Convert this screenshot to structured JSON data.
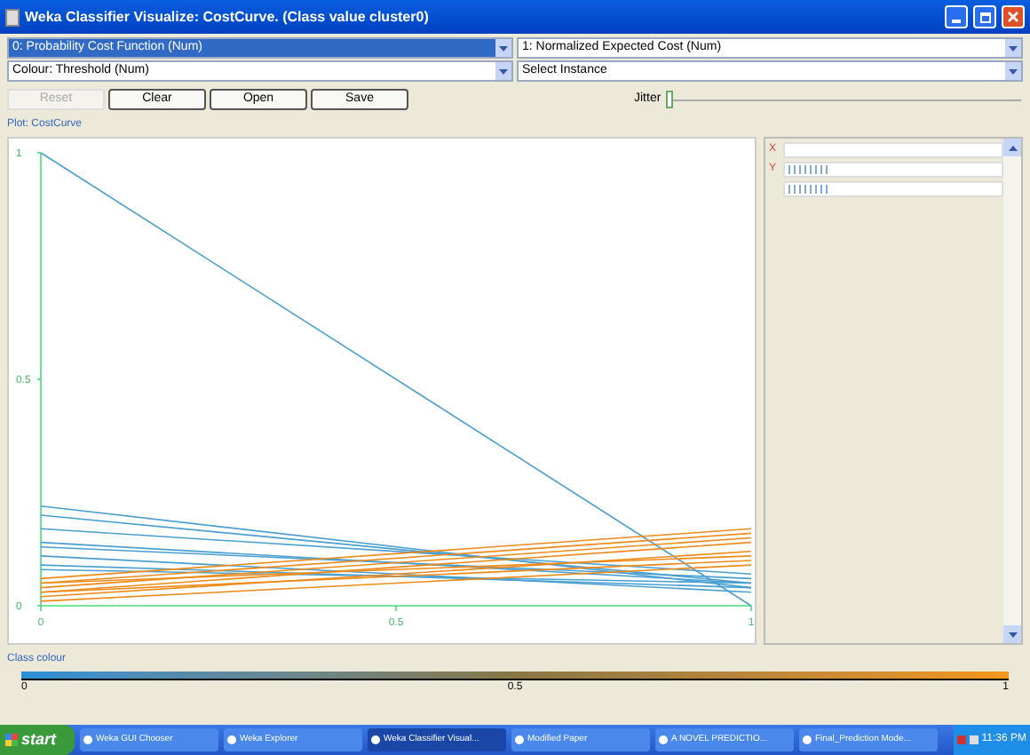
{
  "window": {
    "title": "Weka Classifier Visualize: CostCurve. (Class value cluster0)"
  },
  "axes": [
    {
      "value": "0: Probability Cost Function (Num)",
      "highlighted": true
    },
    {
      "value": "1: Normalized Expected Cost (Num)",
      "highlighted": false
    }
  ],
  "colour_select": {
    "value": "Colour: Threshold (Num)"
  },
  "instance_select": {
    "value": "Select Instance"
  },
  "buttons": [
    {
      "label": "Reset",
      "disabled": true
    },
    {
      "label": "Clear",
      "disabled": false
    },
    {
      "label": "Open",
      "disabled": false
    },
    {
      "label": "Save",
      "disabled": false
    }
  ],
  "jitter": {
    "label": "Jitter",
    "level": 0
  },
  "plot": {
    "title": "Plot: CostCurve",
    "chart_data": {
      "type": "line",
      "x": [
        0,
        1
      ],
      "xlim": [
        0,
        1
      ],
      "ylim": [
        0,
        1
      ],
      "xticks": [
        0,
        0.5,
        1
      ],
      "yticks": [
        0,
        0.5,
        1
      ],
      "series": [
        {
          "color": "#4a9fd0",
          "values": [
            1,
            0
          ]
        },
        {
          "color": "#4a9fd0",
          "values": [
            0.22,
            0.04
          ]
        },
        {
          "color": "#4a9fd0",
          "values": [
            0.2,
            0.05
          ]
        },
        {
          "color": "#4a9fd0",
          "values": [
            0.17,
            0.07
          ]
        },
        {
          "color": "#4a9fd0",
          "values": [
            0.14,
            0.05
          ]
        },
        {
          "color": "#4a9fd0",
          "values": [
            0.13,
            0.06
          ]
        },
        {
          "color": "#4a9fd0",
          "values": [
            0.11,
            0.03
          ]
        },
        {
          "color": "#4a9fd0",
          "values": [
            0.09,
            0.04
          ]
        },
        {
          "color": "#4a9fd0",
          "values": [
            0.08,
            0.05
          ]
        },
        {
          "color": "#ee8a1a",
          "values": [
            0.06,
            0.17
          ]
        },
        {
          "color": "#ee8a1a",
          "values": [
            0.05,
            0.16
          ]
        },
        {
          "color": "#ee8a1a",
          "values": [
            0.04,
            0.15
          ]
        },
        {
          "color": "#ee8a1a",
          "values": [
            0.03,
            0.14
          ]
        },
        {
          "color": "#ee8a1a",
          "values": [
            0.02,
            0.12
          ]
        },
        {
          "color": "#ee8a1a",
          "values": [
            0.05,
            0.11
          ]
        },
        {
          "color": "#ee8a1a",
          "values": [
            0.03,
            0.1
          ]
        },
        {
          "color": "#ee8a1a",
          "values": [
            0.01,
            0.09
          ]
        }
      ]
    }
  },
  "attribute_panel": {
    "rows": [
      {
        "kind": "axis",
        "label": "X"
      },
      {
        "kind": "axis_values",
        "label": "Y"
      },
      {
        "kind": "values"
      }
    ]
  },
  "class_colour": {
    "title": "Class colour",
    "ticks": [
      "0",
      "0.5",
      "1"
    ]
  },
  "taskbar": {
    "start": "start",
    "items": [
      {
        "label": "Weka GUI Chooser",
        "selected": false
      },
      {
        "label": "Weka Explorer",
        "selected": false
      },
      {
        "label": "Weka Classifier Visual...",
        "selected": true
      },
      {
        "label": "Modified Paper",
        "selected": false
      },
      {
        "label": "A NOVEL PREDICTIO...",
        "selected": false
      },
      {
        "label": "Final_Prediction Mode...",
        "selected": false
      }
    ],
    "clock": "11:36 PM"
  }
}
